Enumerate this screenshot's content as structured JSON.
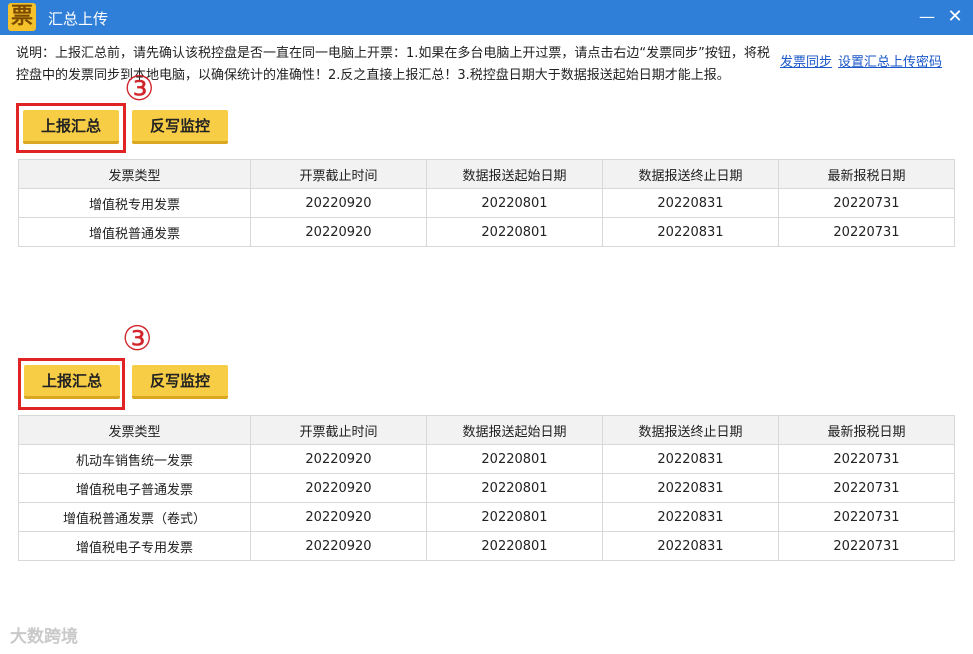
{
  "window": {
    "icon_glyph": "票",
    "title": "汇总上传",
    "minimize_glyph": "—",
    "close_glyph": "✕"
  },
  "description": "说明：上报汇总前，请先确认该税控盘是否一直在同一电脑上开票：1.如果在多台电脑上开过票，请点击右边“发票同步”按钮，将税控盘中的发票同步到本地电脑，以确保统计的准确性！2.反之直接上报汇总！3.税控盘日期大于数据报送起始日期才能上报。",
  "links": {
    "sync": "发票同步",
    "password": "设置汇总上传密码"
  },
  "buttons": {
    "upload": "上报汇总",
    "writeback": "反写监控"
  },
  "annotation": "③",
  "table_headers": [
    "发票类型",
    "开票截止时间",
    "数据报送起始日期",
    "数据报送终止日期",
    "最新报税日期"
  ],
  "table1": {
    "rows": [
      [
        "增值税专用发票",
        "20220920",
        "20220801",
        "20220831",
        "20220731"
      ],
      [
        "增值税普通发票",
        "20220920",
        "20220801",
        "20220831",
        "20220731"
      ]
    ]
  },
  "table2": {
    "rows": [
      [
        "机动车销售统一发票",
        "20220920",
        "20220801",
        "20220831",
        "20220731"
      ],
      [
        "增值税电子普通发票",
        "20220920",
        "20220801",
        "20220831",
        "20220731"
      ],
      [
        "增值税普通发票（卷式）",
        "20220920",
        "20220801",
        "20220831",
        "20220731"
      ],
      [
        "增值税电子专用发票",
        "20220920",
        "20220801",
        "20220831",
        "20220731"
      ]
    ]
  },
  "watermark": "大数跨境",
  "colors": {
    "titlebar": "#2f7fd8",
    "button": "#f7cd45",
    "highlight": "#e02424",
    "link": "#1a57c9"
  }
}
